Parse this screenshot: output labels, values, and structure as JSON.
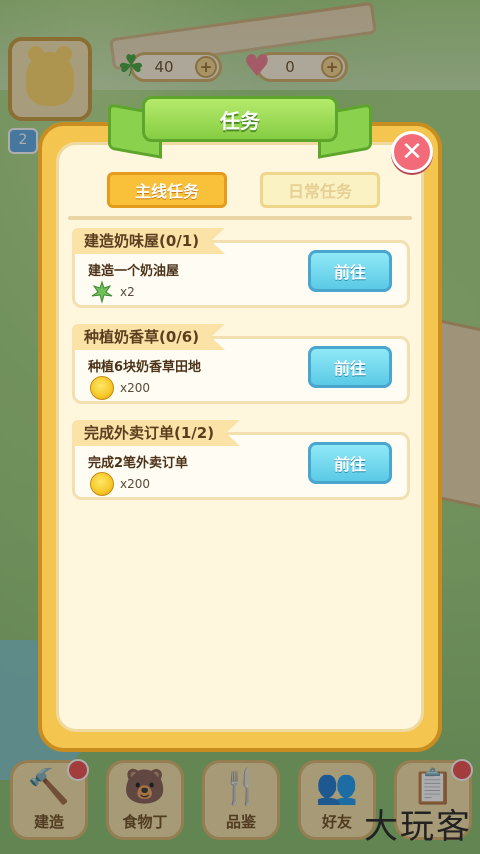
{
  "hud": {
    "clover_count": "40",
    "heart_count": "0",
    "level": "2",
    "plus_label": "+"
  },
  "dialog": {
    "title": "任务",
    "close_label": "✕",
    "tabs": [
      {
        "label": "主线任务",
        "active": true
      },
      {
        "label": "日常任务",
        "active": false
      }
    ],
    "tasks": [
      {
        "title": "建造奶味屋(0/1)",
        "desc": "建造一个奶油屋",
        "reward_icon": "herb-icon",
        "reward_count": "x2",
        "button": "前往"
      },
      {
        "title": "种植奶香草(0/6)",
        "desc": "种植6块奶香草田地",
        "reward_icon": "coin-icon",
        "reward_count": "x200",
        "button": "前往"
      },
      {
        "title": "完成外卖订单(1/2)",
        "desc": "完成2笔外卖订单",
        "reward_icon": "coin-icon",
        "reward_count": "x200",
        "button": "前往"
      }
    ]
  },
  "nav": [
    {
      "label": "建造",
      "icon": "build-icon",
      "badge": true
    },
    {
      "label": "食物丁",
      "icon": "bear-chef-icon",
      "badge": false
    },
    {
      "label": "品鉴",
      "icon": "fork-spoon-icon",
      "badge": false
    },
    {
      "label": "好友",
      "icon": "friends-icon",
      "badge": false
    },
    {
      "label": "",
      "icon": "clipboard-icon",
      "badge": true
    }
  ],
  "watermark": "大玩客",
  "colors": {
    "dialog_frame": "#f5c64f",
    "ribbon_green": "#86cd44",
    "go_button": "#5bc9e6",
    "close_button": "#f36b78"
  }
}
